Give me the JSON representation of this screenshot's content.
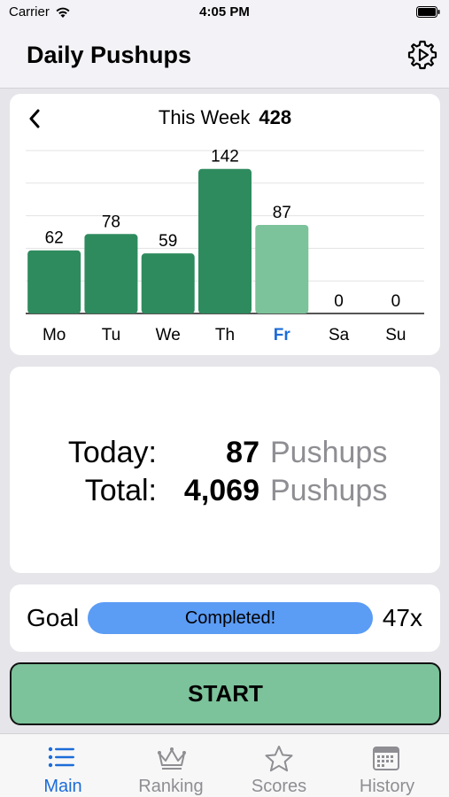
{
  "status_bar": {
    "carrier": "Carrier",
    "time": "4:05 PM"
  },
  "header": {
    "title": "Daily Pushups"
  },
  "week": {
    "title": "This Week",
    "total": "428"
  },
  "chart_data": {
    "type": "bar",
    "categories": [
      "Mo",
      "Tu",
      "We",
      "Th",
      "Fr",
      "Sa",
      "Su"
    ],
    "values": [
      62,
      78,
      59,
      142,
      87,
      0,
      0
    ],
    "highlight_category": "Fr",
    "ylim": [
      0,
      160
    ],
    "grid": true,
    "colors": {
      "bar": "#2e8b5e",
      "highlight_bar": "#7cc29a",
      "highlight_label": "#1c6cd8"
    }
  },
  "stats": {
    "today_label": "Today:",
    "today_value": "87",
    "total_label": "Total:",
    "total_value": "4,069",
    "unit": "Pushups"
  },
  "goal": {
    "label": "Goal",
    "status": "Completed!",
    "count": "47x",
    "progress": 1.0
  },
  "start_button": {
    "label": "START"
  },
  "tabs": [
    {
      "label": "Main",
      "icon": "list-icon",
      "active": true
    },
    {
      "label": "Ranking",
      "icon": "crown-icon",
      "active": false
    },
    {
      "label": "Scores",
      "icon": "star-icon",
      "active": false
    },
    {
      "label": "History",
      "icon": "calendar-icon",
      "active": false
    }
  ],
  "colors": {
    "accent": "#1c6cd8",
    "goal_bar": "#5b9cf5",
    "start_button": "#7cc29a"
  }
}
